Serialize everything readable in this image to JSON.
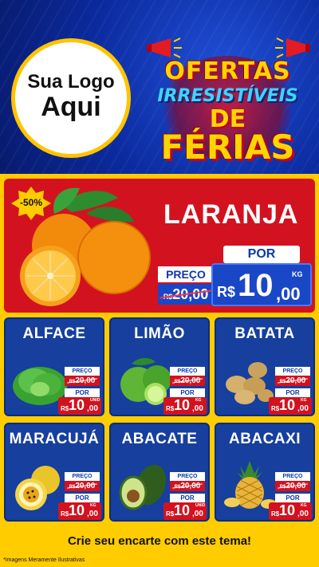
{
  "header": {
    "logo_line1": "Sua Logo",
    "logo_line2": "Aqui",
    "promo_line1": "OFERTAS",
    "promo_line2": "IRRESISTÍVEIS",
    "promo_line3": "DE",
    "promo_line4": "FÉRIAS"
  },
  "colors": {
    "brand_blue": "#163f9e",
    "brand_red": "#d3121f",
    "brand_yellow": "#ffcc00"
  },
  "hero": {
    "badge": "-50%",
    "product": "LARANJA",
    "preco_label": "PREÇO",
    "old_currency": "R$",
    "old_price": "20,00",
    "por_label": "POR",
    "currency": "R$",
    "price_int": "10",
    "price_dec": ",00",
    "unit": "KG",
    "icon": "orange-icon"
  },
  "products": [
    {
      "name": "ALFACE",
      "preco_label": "PREÇO",
      "old_currency": "R$",
      "old_price": "20,00",
      "por_label": "POR",
      "currency": "R$",
      "price_int": "10",
      "price_dec": ",00",
      "unit": "UNID",
      "icon": "lettuce-icon"
    },
    {
      "name": "LIMÃO",
      "preco_label": "PREÇO",
      "old_currency": "R$",
      "old_price": "20,00",
      "por_label": "POR",
      "currency": "R$",
      "price_int": "10",
      "price_dec": ",00",
      "unit": "KG",
      "icon": "lime-icon"
    },
    {
      "name": "BATATA",
      "preco_label": "PREÇO",
      "old_currency": "R$",
      "old_price": "20,00",
      "por_label": "POR",
      "currency": "R$",
      "price_int": "10",
      "price_dec": ",00",
      "unit": "KG",
      "icon": "potato-icon"
    },
    {
      "name": "MARACUJÁ",
      "preco_label": "PREÇO",
      "old_currency": "R$",
      "old_price": "20,00",
      "por_label": "POR",
      "currency": "R$",
      "price_int": "10",
      "price_dec": ",00",
      "unit": "KG",
      "icon": "passion-fruit-icon"
    },
    {
      "name": "ABACATE",
      "preco_label": "PREÇO",
      "old_currency": "R$",
      "old_price": "20,00",
      "por_label": "POR",
      "currency": "R$",
      "price_int": "10",
      "price_dec": ",00",
      "unit": "UNID",
      "icon": "avocado-icon"
    },
    {
      "name": "ABACAXI",
      "preco_label": "PREÇO",
      "old_currency": "R$",
      "old_price": "20,00",
      "por_label": "POR",
      "currency": "R$",
      "price_int": "10",
      "price_dec": ",00",
      "unit": "KG",
      "icon": "pineapple-icon"
    }
  ],
  "footer": {
    "cta": "Crie seu encarte com este tema!",
    "note": "*Imagens Meramente Ilustrativas"
  }
}
